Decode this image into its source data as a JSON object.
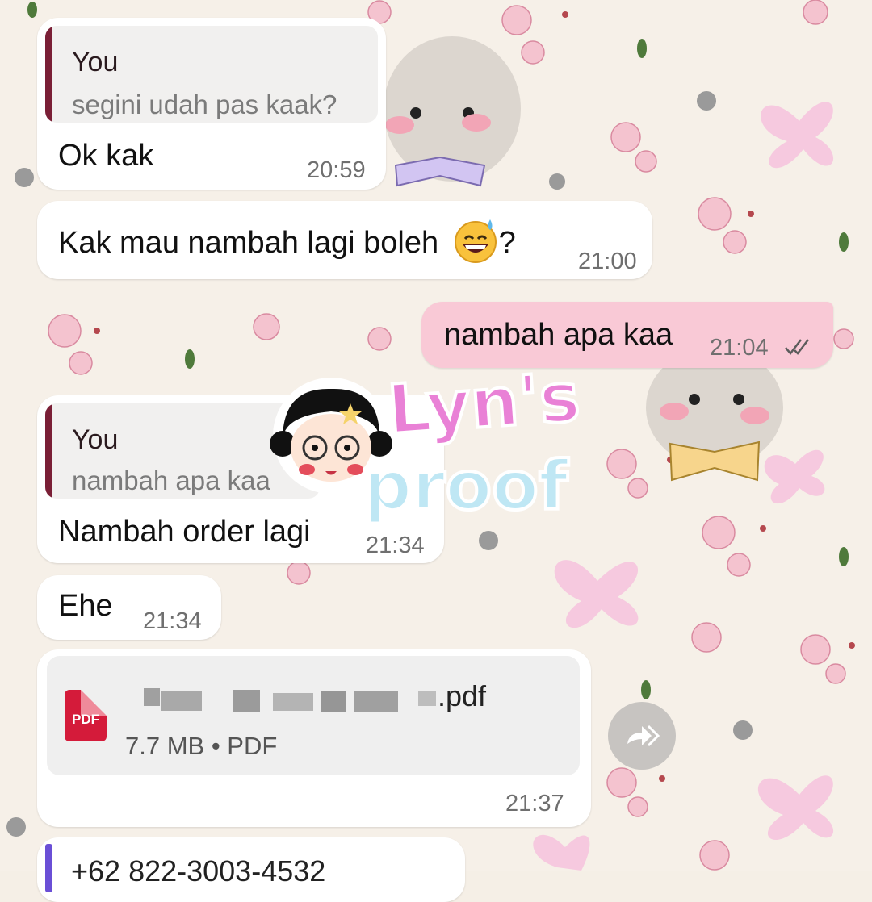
{
  "colors": {
    "incoming_bubble": "#ffffff",
    "outgoing_bubble": "#f9c9d6",
    "quote_bar": "#7a1f36",
    "timestamp": "#6f6f6f",
    "pdf_icon": "#d41b3a",
    "contact_bar": "#6a4fd6"
  },
  "messages": [
    {
      "direction": "incoming",
      "quote": {
        "author": "You",
        "text": "segini udah pas kaak?"
      },
      "text": "Ok kak",
      "time": "20:59"
    },
    {
      "direction": "incoming",
      "text": "Kak mau nambah lagi boleh",
      "emoji": "grinning-sweat-emoji",
      "text_suffix": "?",
      "time": "21:00"
    },
    {
      "direction": "outgoing",
      "text": "nambah apa kaa",
      "time": "21:04",
      "status_icon": "double-check-icon"
    },
    {
      "direction": "incoming",
      "quote": {
        "author": "You",
        "text": "nambah apa kaa"
      },
      "text": "Nambah order lagi",
      "time": "21:34"
    },
    {
      "direction": "incoming",
      "text": "Ehe",
      "time": "21:34"
    },
    {
      "direction": "incoming",
      "type": "document",
      "document": {
        "icon_label": "PDF",
        "filename_suffix": ".pdf",
        "meta": "7.7 MB • PDF"
      },
      "forward_icon": "forward-icon",
      "time": "21:37"
    },
    {
      "direction": "incoming",
      "type": "contact",
      "partial_text": "+62 822-3003-4532"
    }
  ],
  "watermark": {
    "line1": "Lyn's",
    "line2": "proof"
  }
}
